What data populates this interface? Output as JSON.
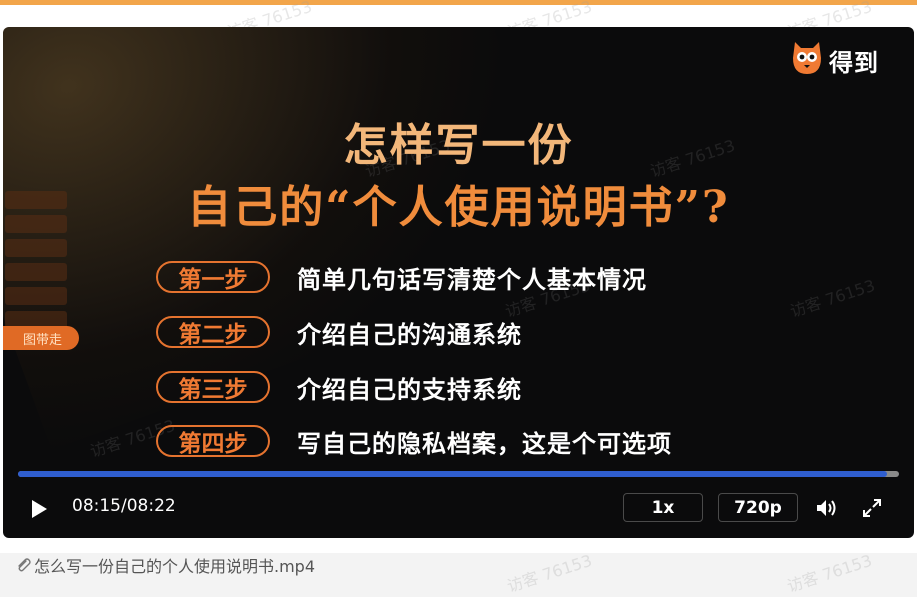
{
  "watermark_text": "访客 76153",
  "brand": {
    "name": "得到"
  },
  "slide": {
    "title_line1": "怎样写一份",
    "title_line2": "自己的“个人使用说明书”?",
    "steps": [
      {
        "badge": "第一步",
        "text": "简单几句话写清楚个人基本情况"
      },
      {
        "badge": "第二步",
        "text": "介绍自己的沟通系统"
      },
      {
        "badge": "第三步",
        "text": "介绍自己的支持系统"
      },
      {
        "badge": "第四步",
        "text": "写自己的隐私档案，这是个可选项"
      }
    ],
    "side_tab_active": "图带走"
  },
  "player": {
    "progress": 0.986,
    "current_time": "08:15",
    "separator": "/",
    "duration": "08:22",
    "speed": "1x",
    "quality": "720p"
  },
  "file": {
    "name": "怎么写一份自己的个人使用说明书.mp4"
  },
  "colors": {
    "accent_orange": "#f08c3c",
    "progress_blue": "#2f5ecf",
    "top_bar": "#f2a54a"
  }
}
